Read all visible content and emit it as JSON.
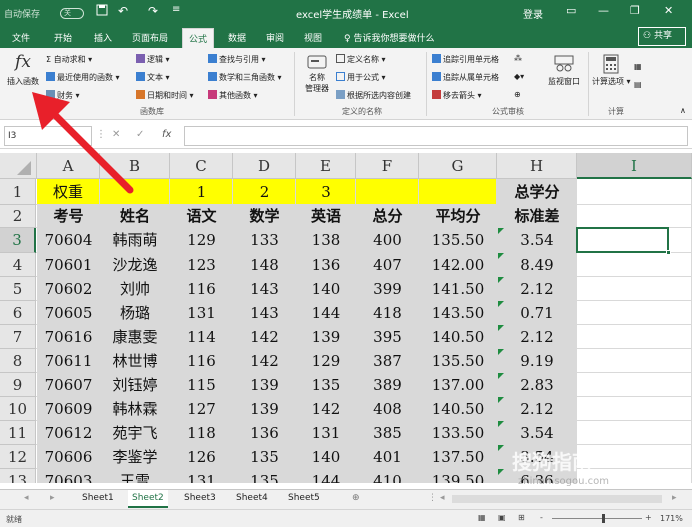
{
  "titlebar": {
    "autosave": "自动保存",
    "toggle": "关",
    "doc_title": "excel学生成绩单 - Excel",
    "login": "登录",
    "icons": [
      "save-icon",
      "undo-icon",
      "redo-icon",
      "customize-icon"
    ],
    "window_icons": [
      "ribbon-display-icon",
      "minimize-icon",
      "restore-icon",
      "close-icon"
    ]
  },
  "tabs": [
    "文件",
    "开始",
    "插入",
    "页面布局",
    "公式",
    "数据",
    "审阅",
    "视图"
  ],
  "active_tab": "公式",
  "tell_me": "告诉我你想要做什么",
  "share": "共享",
  "ribbon": {
    "insert_function": {
      "symbol": "fx",
      "label": "插入函数"
    },
    "library": [
      "自动求和",
      "最近使用的函数",
      "财务",
      "逻辑",
      "文本",
      "日期和时间",
      "查找与引用",
      "数学和三角函数",
      "其他函数"
    ],
    "library_group": "函数库",
    "name_manager": [
      "名称",
      "管理器"
    ],
    "names": [
      "定义名称",
      "用于公式",
      "根据所选内容创建"
    ],
    "names_group": "定义的名称",
    "audit": [
      "追踪引用单元格",
      "追踪从属单元格",
      "移去箭头"
    ],
    "audit_group": "公式审核",
    "watch": "监视窗口",
    "calc_options": "计算选项",
    "calc_group": "计算"
  },
  "formula_bar": {
    "name_box": "I3",
    "cancel": "✕",
    "enter": "✓",
    "fx": "fx",
    "value": ""
  },
  "columns": [
    "A",
    "B",
    "C",
    "D",
    "E",
    "F",
    "G",
    "H",
    "I"
  ],
  "rows": [
    "1",
    "2",
    "3",
    "4",
    "5",
    "6",
    "7",
    "8",
    "9",
    "10",
    "11",
    "12",
    "13"
  ],
  "sheet": {
    "row1": [
      "权重",
      "",
      "1",
      "2",
      "3",
      "",
      "",
      "总学分",
      ""
    ],
    "row2": [
      "考号",
      "姓名",
      "语文",
      "数学",
      "英语",
      "总分",
      "平均分",
      "标准差",
      ""
    ],
    "data": [
      [
        "70604",
        "韩雨萌",
        "129",
        "133",
        "138",
        "400",
        "135.50",
        "3.54"
      ],
      [
        "70601",
        "沙龙逸",
        "123",
        "148",
        "136",
        "407",
        "142.00",
        "8.49"
      ],
      [
        "70602",
        "刘帅",
        "116",
        "143",
        "140",
        "399",
        "141.50",
        "2.12"
      ],
      [
        "70605",
        "杨璐",
        "131",
        "143",
        "144",
        "418",
        "143.50",
        "0.71"
      ],
      [
        "70616",
        "康惠雯",
        "114",
        "142",
        "139",
        "395",
        "140.50",
        "2.12"
      ],
      [
        "70611",
        "林世博",
        "116",
        "142",
        "129",
        "387",
        "135.50",
        "9.19"
      ],
      [
        "70607",
        "刘钰婷",
        "115",
        "139",
        "135",
        "389",
        "137.00",
        "2.83"
      ],
      [
        "70609",
        "韩林霖",
        "127",
        "139",
        "142",
        "408",
        "140.50",
        "2.12"
      ],
      [
        "70612",
        "苑宇飞",
        "118",
        "136",
        "131",
        "385",
        "133.50",
        "3.54"
      ],
      [
        "70606",
        "李鉴学",
        "126",
        "135",
        "140",
        "401",
        "137.50",
        "3.54"
      ],
      [
        "70603",
        "王雪",
        "131",
        "135",
        "144",
        "410",
        "139.50",
        "6.36"
      ]
    ]
  },
  "sheet_tabs": [
    "Sheet1",
    "Sheet2",
    "Sheet3",
    "Sheet4",
    "Sheet5"
  ],
  "active_sheet": "Sheet2",
  "status": {
    "mode": "就绪",
    "zoom": "171%",
    "minus": "-",
    "plus": "+"
  },
  "watermark": {
    "text": "搜狗指南",
    "url": "zhinan.sogou.com"
  },
  "colors": {
    "excel_green": "#217346",
    "yellow": "#ffff00",
    "gray": "#d9d9d9",
    "arrow": "#e8202a"
  }
}
